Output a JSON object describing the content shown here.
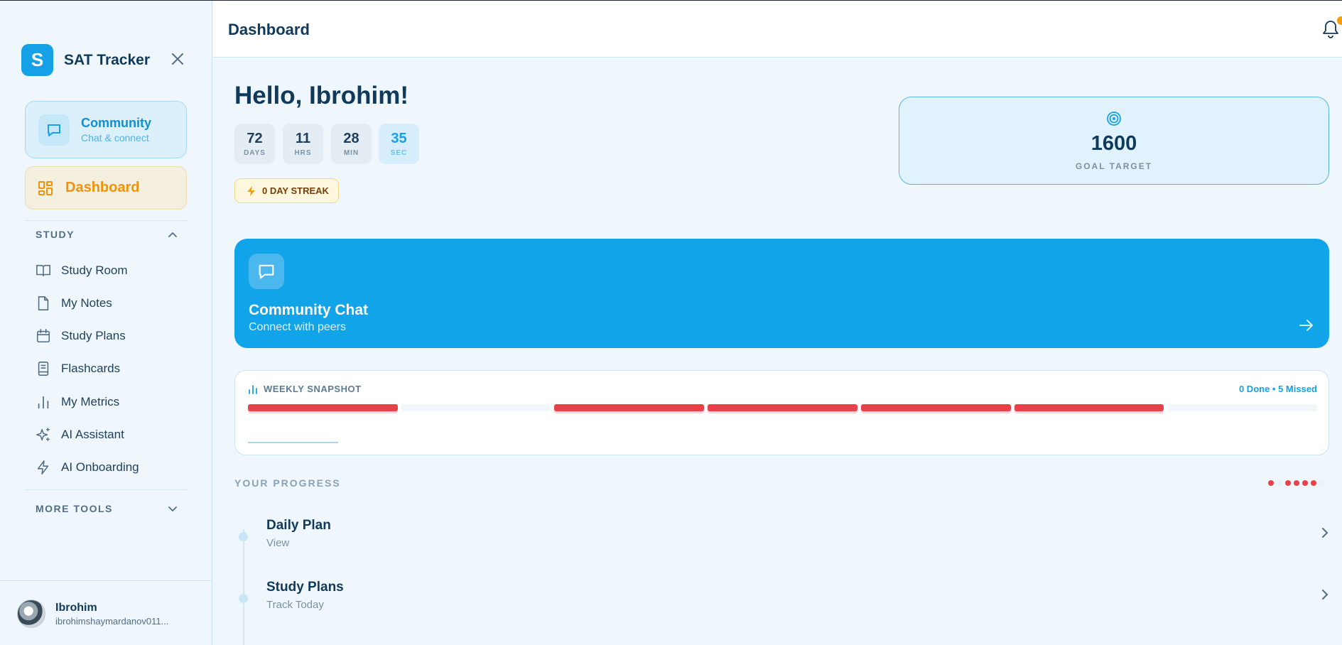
{
  "app": {
    "brand_letter": "S",
    "brand_name": "SAT Tracker"
  },
  "sidebar": {
    "community": {
      "title": "Community",
      "subtitle": "Chat & connect"
    },
    "dashboard_label": "Dashboard",
    "study_section": "STUDY",
    "study_items": [
      {
        "label": "Study Room",
        "icon": "book-open-icon"
      },
      {
        "label": "My Notes",
        "icon": "file-icon"
      },
      {
        "label": "Study Plans",
        "icon": "calendar-icon"
      },
      {
        "label": "Flashcards",
        "icon": "notebook-icon"
      },
      {
        "label": "My Metrics",
        "icon": "bar-chart-icon"
      },
      {
        "label": "AI Assistant",
        "icon": "sparkles-icon"
      },
      {
        "label": "AI Onboarding",
        "icon": "lightning-icon"
      }
    ],
    "more_tools_section": "MORE TOOLS",
    "user": {
      "name": "Ibrohim",
      "email": "ibrohimshaymardanov011..."
    }
  },
  "header": {
    "title": "Dashboard"
  },
  "main": {
    "greeting": "Hello, Ibrohim!",
    "countdown": [
      {
        "value": "72",
        "label": "DAYS"
      },
      {
        "value": "11",
        "label": "HRS"
      },
      {
        "value": "28",
        "label": "MIN"
      },
      {
        "value": "35",
        "label": "SEC"
      }
    ],
    "streak_label": "0 DAY STREAK",
    "goal": {
      "value": "1600",
      "label": "GOAL TARGET"
    },
    "chat_banner": {
      "title": "Community Chat",
      "subtitle": "Connect with peers"
    },
    "snapshot": {
      "title": "WEEKLY SNAPSHOT",
      "status": "0 Done • 5 Missed",
      "days": [
        "missed",
        "empty",
        "missed",
        "missed",
        "missed",
        "missed",
        "empty"
      ]
    },
    "progress_title": "YOUR PROGRESS",
    "progress_dots": [
      "missed",
      "empty",
      "missed",
      "missed",
      "missed",
      "missed",
      "empty"
    ],
    "progress_items": [
      {
        "title": "Daily Plan",
        "subtitle": "View"
      },
      {
        "title": "Study Plans",
        "subtitle": "Track Today"
      }
    ]
  },
  "colors": {
    "accent": "#16a1e6",
    "missed": "#e9414a",
    "streak": "#f59e0b",
    "dashboard_active": "#f0930c"
  }
}
